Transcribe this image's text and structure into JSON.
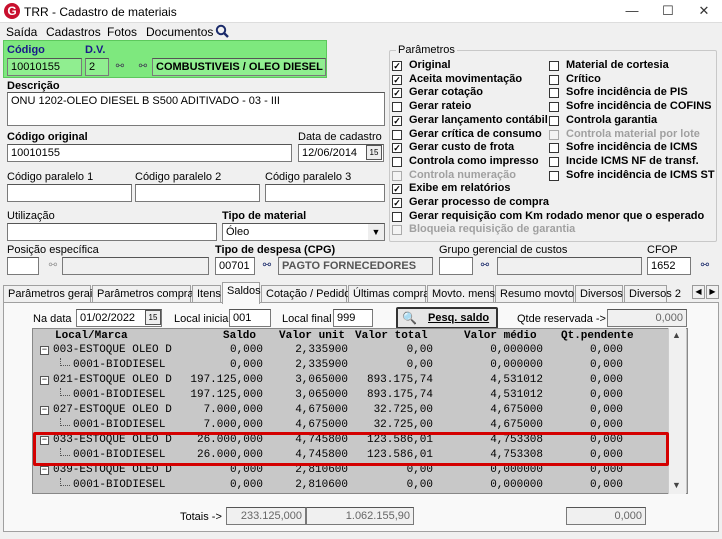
{
  "window": {
    "title": "TRR - Cadastro de materiais",
    "logo_letter": "G",
    "min": "—",
    "max": "☐",
    "close": "✕"
  },
  "menu": [
    "Saída",
    "Cadastros",
    "Fotos",
    "Documentos"
  ],
  "fields": {
    "codigo_label": "Código",
    "codigo": "10010155",
    "dv_label": "D.V.",
    "dv": "2",
    "grupo": "COMBUSTIVEIS / OLEO DIESEL",
    "descricao_label": "Descrição",
    "descricao": "ONU 1202-OLEO DIESEL B S500 ADITIVADO - 03 - III",
    "codigo_original_label": "Código original",
    "codigo_original": "10010155",
    "data_cadastro_label": "Data de cadastro",
    "data_cadastro": "12/06/2014",
    "cod_paralelo1_label": "Código paralelo 1",
    "cod_paralelo1": "",
    "cod_paralelo2_label": "Código paralelo 2",
    "cod_paralelo2": "",
    "cod_paralelo3_label": "Código paralelo 3",
    "cod_paralelo3": "",
    "utilizacao_label": "Utilização",
    "utilizacao": "",
    "tipo_material_label": "Tipo de material",
    "tipo_material": "Óleo",
    "posicao_label": "Posição específica",
    "tipo_despesa_label": "Tipo de despesa (CPG)",
    "tipo_despesa_cod": "00701",
    "tipo_despesa": "PAGTO FORNECEDORES",
    "grupo_gerencial_label": "Grupo gerencial de custos",
    "cfop_label": "CFOP",
    "cfop": "1652"
  },
  "parametros": {
    "legend": "Parâmetros",
    "left": [
      {
        "label": "Original",
        "checked": true,
        "disabled": false
      },
      {
        "label": "Aceita movimentação",
        "checked": true,
        "disabled": false
      },
      {
        "label": "Gerar cotação",
        "checked": true,
        "disabled": false
      },
      {
        "label": "Gerar rateio",
        "checked": false,
        "disabled": false
      },
      {
        "label": "Gerar lançamento contábil",
        "checked": true,
        "disabled": false
      },
      {
        "label": "Gerar crítica de consumo",
        "checked": false,
        "disabled": false
      },
      {
        "label": "Gerar custo de frota",
        "checked": true,
        "disabled": false
      },
      {
        "label": "Controla como impresso",
        "checked": false,
        "disabled": false
      },
      {
        "label": "Controla numeração",
        "checked": false,
        "disabled": true
      },
      {
        "label": "Exibe em relatórios",
        "checked": true,
        "disabled": false
      },
      {
        "label": "Gerar processo de compra",
        "checked": true,
        "disabled": false
      },
      {
        "label": "Gerar requisição com Km rodado menor que o esperado",
        "checked": false,
        "disabled": false
      },
      {
        "label": "Bloqueia requisição de garantia",
        "checked": false,
        "disabled": true
      }
    ],
    "right": [
      {
        "label": "Material de cortesia",
        "checked": false,
        "disabled": false
      },
      {
        "label": "Crítico",
        "checked": false,
        "disabled": false
      },
      {
        "label": "Sofre incidência de PIS",
        "checked": false,
        "disabled": false
      },
      {
        "label": "Sofre incidência de COFINS",
        "checked": false,
        "disabled": false
      },
      {
        "label": "Controla garantia",
        "checked": false,
        "disabled": false
      },
      {
        "label": "Controla material por lote",
        "checked": false,
        "disabled": true
      },
      {
        "label": "Sofre incidência de ICMS",
        "checked": false,
        "disabled": false
      },
      {
        "label": "Incide ICMS NF de transf.",
        "checked": false,
        "disabled": false
      },
      {
        "label": "Sofre incidência de ICMS ST",
        "checked": false,
        "disabled": false
      }
    ]
  },
  "tabs": [
    "Parâmetros gerais",
    "Parâmetros compras",
    "Itens",
    "Saldos",
    "Cotação / Pedido",
    "Últimas compras",
    "Movto. mensal",
    "Resumo movto.",
    "Diversos",
    "Diversos 2"
  ],
  "active_tab": 3,
  "saldos": {
    "na_data_label": "Na data",
    "na_data": "01/02/2022",
    "local_inicial_label": "Local inicial",
    "local_inicial": "001",
    "local_final_label": "Local final",
    "local_final": "999",
    "pesq_button": "Pesq. saldo",
    "qtde_reservada_label": "Qtde reservada ->",
    "qtde_reservada": "0,000",
    "headers": [
      "Local/Marca",
      "Saldo",
      "Valor unit",
      "Valor total",
      "Valor médio",
      "Qt.pendente"
    ],
    "rows": [
      {
        "level": 0,
        "name": "003-ESTOQUE OLEO D",
        "saldo": "0,000",
        "vunit": "2,335900",
        "vtotal": "0,00",
        "vmedio": "0,000000",
        "qtpend": "0,000"
      },
      {
        "level": 1,
        "name": "0001-BIODIESEL",
        "saldo": "0,000",
        "vunit": "2,335900",
        "vtotal": "0,00",
        "vmedio": "0,000000",
        "qtpend": "0,000"
      },
      {
        "level": 0,
        "name": "021-ESTOQUE OLEO D",
        "saldo": "197.125,000",
        "vunit": "3,065000",
        "vtotal": "893.175,74",
        "vmedio": "4,531012",
        "qtpend": "0,000"
      },
      {
        "level": 1,
        "name": "0001-BIODIESEL",
        "saldo": "197.125,000",
        "vunit": "3,065000",
        "vtotal": "893.175,74",
        "vmedio": "4,531012",
        "qtpend": "0,000"
      },
      {
        "level": 0,
        "name": "027-ESTOQUE OLEO D",
        "saldo": "7.000,000",
        "vunit": "4,675000",
        "vtotal": "32.725,00",
        "vmedio": "4,675000",
        "qtpend": "0,000"
      },
      {
        "level": 1,
        "name": "0001-BIODIESEL",
        "saldo": "7.000,000",
        "vunit": "4,675000",
        "vtotal": "32.725,00",
        "vmedio": "4,675000",
        "qtpend": "0,000"
      },
      {
        "level": 0,
        "name": "033-ESTOQUE OLEO D",
        "saldo": "26.000,000",
        "vunit": "4,745800",
        "vtotal": "123.586,01",
        "vmedio": "4,753308",
        "qtpend": "0,000"
      },
      {
        "level": 1,
        "name": "0001-BIODIESEL",
        "saldo": "26.000,000",
        "vunit": "4,745800",
        "vtotal": "123.586,01",
        "vmedio": "4,753308",
        "qtpend": "0,000"
      },
      {
        "level": 0,
        "name": "039-ESTOQUE OLEO D",
        "saldo": "0,000",
        "vunit": "2,810600",
        "vtotal": "0,00",
        "vmedio": "0,000000",
        "qtpend": "0,000"
      },
      {
        "level": 1,
        "name": "0001-BIODIESEL",
        "saldo": "0,000",
        "vunit": "2,810600",
        "vtotal": "0,00",
        "vmedio": "0,000000",
        "qtpend": "0,000"
      }
    ],
    "totais_label": "Totais ->",
    "total_saldo": "233.125,000",
    "total_valor": "1.062.155,90",
    "total_qtpend": "0,000"
  }
}
